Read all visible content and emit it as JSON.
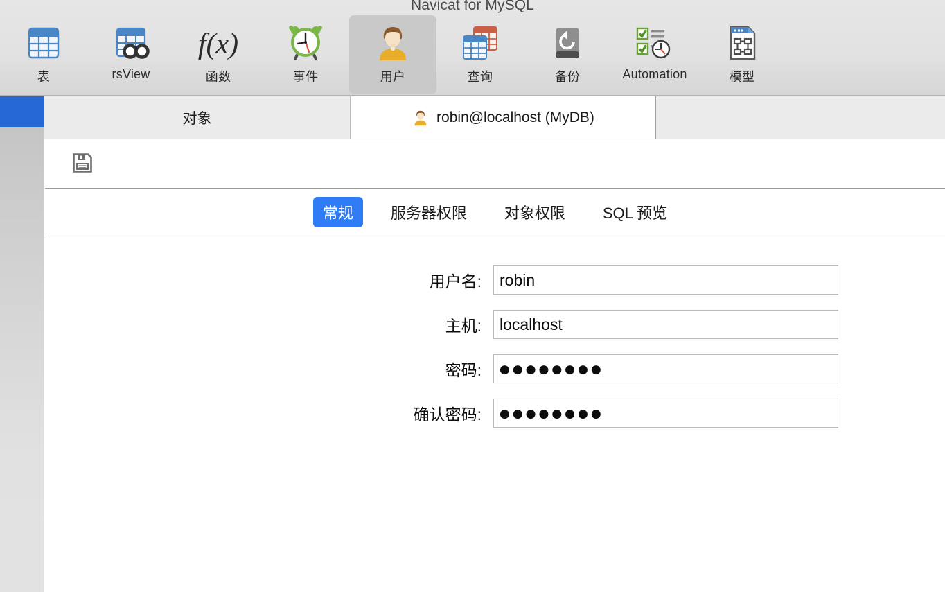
{
  "window": {
    "title": "Navicat for MySQL"
  },
  "toolbar": {
    "items": [
      {
        "label": "表",
        "icon": "table-icon"
      },
      {
        "label": "rsView",
        "icon": "view-icon"
      },
      {
        "label": "函数",
        "icon": "function-fx-icon"
      },
      {
        "label": "事件",
        "icon": "alarm-clock-icon"
      },
      {
        "label": "用户",
        "icon": "user-icon",
        "selected": true
      },
      {
        "label": "查询",
        "icon": "query-tables-icon"
      },
      {
        "label": "备份",
        "icon": "backup-restore-icon"
      },
      {
        "label": "Automation",
        "icon": "automation-checklist-clock-icon"
      },
      {
        "label": "模型",
        "icon": "model-diagram-icon"
      }
    ]
  },
  "tabs": {
    "object_tab": "对象",
    "user_tab": "robin@localhost (MyDB)"
  },
  "editor_toolbar": {
    "save_label": "保存",
    "save_icon": "floppy-save-icon"
  },
  "segments": {
    "items": [
      {
        "label": "常规",
        "active": true
      },
      {
        "label": "服务器权限",
        "active": false
      },
      {
        "label": "对象权限",
        "active": false
      },
      {
        "label": "SQL 预览",
        "active": false
      }
    ]
  },
  "form": {
    "fields": [
      {
        "label": "用户名:",
        "value": "robin",
        "type": "text"
      },
      {
        "label": "主机:",
        "value": "localhost",
        "type": "text"
      },
      {
        "label": "密码:",
        "value": "●●●●●●●●",
        "type": "password"
      },
      {
        "label": "确认密码:",
        "value": "●●●●●●●●",
        "type": "password"
      }
    ]
  },
  "colors": {
    "accent_blue": "#2f7cf6",
    "sidebar_selection": "#2667d6",
    "toolbar_bg": "#e2e2e2",
    "tab_inactive": "#ebebeb"
  }
}
